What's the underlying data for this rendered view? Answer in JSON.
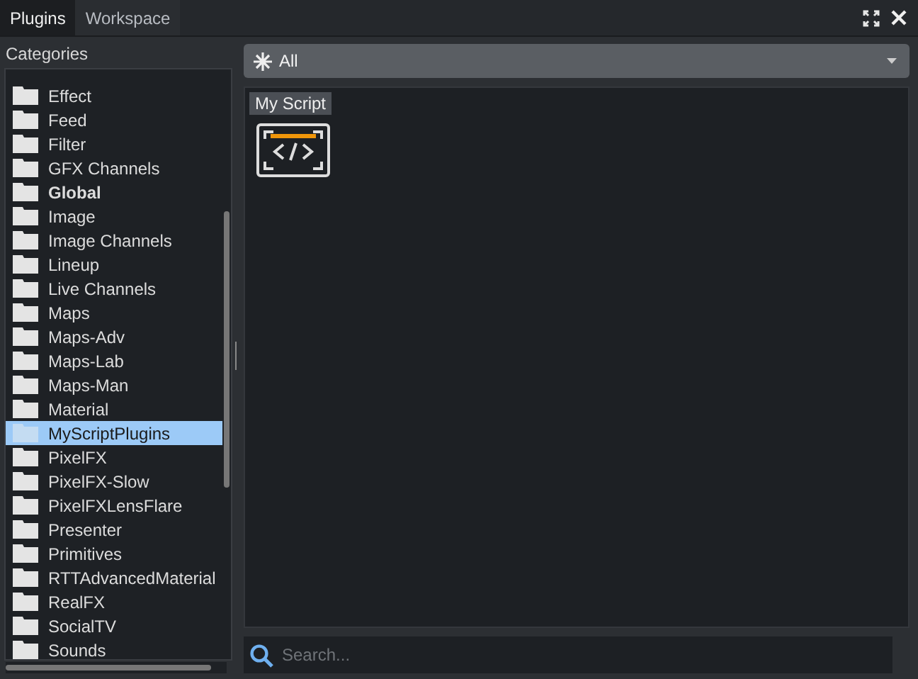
{
  "tabs": [
    {
      "label": "Plugins",
      "selected": true
    },
    {
      "label": "Workspace",
      "selected": false
    }
  ],
  "sidebar": {
    "title": "Categories",
    "items": [
      {
        "label": "Effect",
        "bold": false,
        "selected": false
      },
      {
        "label": "Feed",
        "bold": false,
        "selected": false
      },
      {
        "label": "Filter",
        "bold": false,
        "selected": false
      },
      {
        "label": "GFX Channels",
        "bold": false,
        "selected": false
      },
      {
        "label": "Global",
        "bold": true,
        "selected": false
      },
      {
        "label": "Image",
        "bold": false,
        "selected": false
      },
      {
        "label": "Image Channels",
        "bold": false,
        "selected": false
      },
      {
        "label": "Lineup",
        "bold": false,
        "selected": false
      },
      {
        "label": "Live Channels",
        "bold": false,
        "selected": false
      },
      {
        "label": "Maps",
        "bold": false,
        "selected": false
      },
      {
        "label": "Maps-Adv",
        "bold": false,
        "selected": false
      },
      {
        "label": "Maps-Lab",
        "bold": false,
        "selected": false
      },
      {
        "label": "Maps-Man",
        "bold": false,
        "selected": false
      },
      {
        "label": "Material",
        "bold": false,
        "selected": false
      },
      {
        "label": "MyScriptPlugins",
        "bold": false,
        "selected": true
      },
      {
        "label": "PixelFX",
        "bold": false,
        "selected": false
      },
      {
        "label": "PixelFX-Slow",
        "bold": false,
        "selected": false
      },
      {
        "label": "PixelFXLensFlare",
        "bold": false,
        "selected": false
      },
      {
        "label": "Presenter",
        "bold": false,
        "selected": false
      },
      {
        "label": "Primitives",
        "bold": false,
        "selected": false
      },
      {
        "label": "RTTAdvancedMaterial",
        "bold": false,
        "selected": false
      },
      {
        "label": "RealFX",
        "bold": false,
        "selected": false
      },
      {
        "label": "SocialTV",
        "bold": false,
        "selected": false
      },
      {
        "label": "Sounds",
        "bold": false,
        "selected": false
      }
    ]
  },
  "filter": {
    "value": "All"
  },
  "plugins": [
    {
      "label": "My Script"
    }
  ],
  "search": {
    "placeholder": "Search..."
  }
}
